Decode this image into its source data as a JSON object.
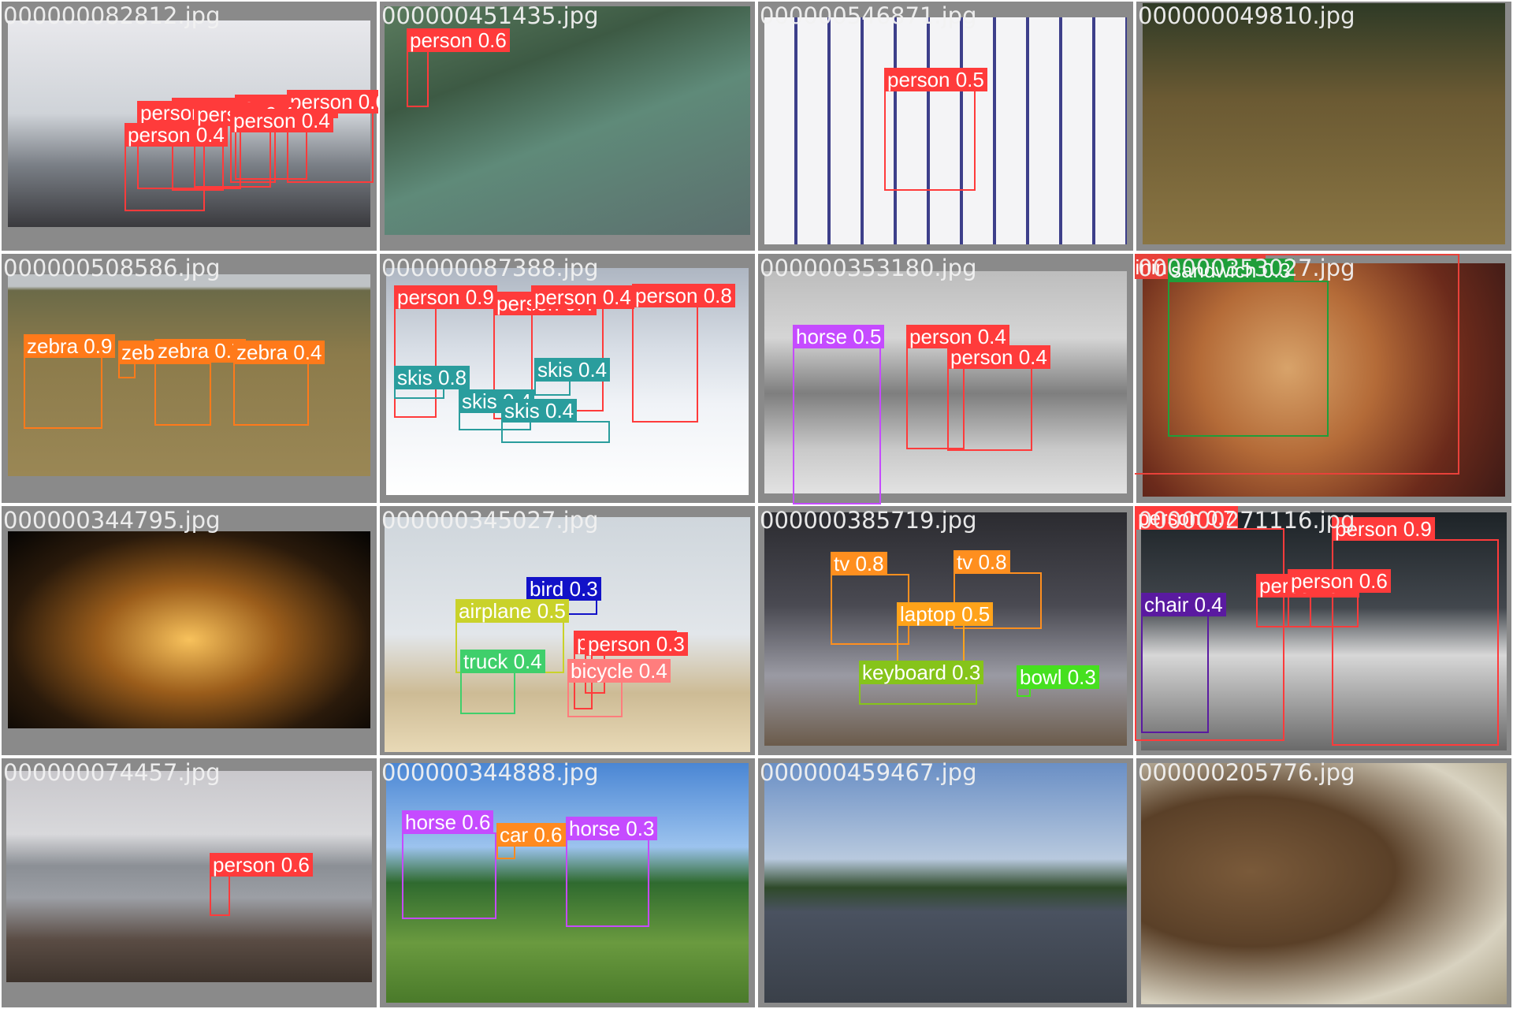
{
  "colors": {
    "person": "#ff3b3b",
    "zebra": "#ff7a1a",
    "skis": "#2a9d9d",
    "horse": "#c54bff",
    "sandwich": "#1f9e3a",
    "dining_table": "#e8413a",
    "bird": "#1212c8",
    "airplane": "#c9d22a",
    "truck": "#3fcf6b",
    "bicycle": "#ff7d7d",
    "tv": "#ff8f1f",
    "laptop": "#ffa31a",
    "keyboard": "#86c41a",
    "bowl": "#46e01f",
    "chair": "#5a1aa0",
    "car": "#ff8a1f"
  },
  "tiles": [
    {
      "filename": "000000082812.jpg",
      "labels": [
        "person 0.4",
        "person 0.6",
        "person 0.4",
        "person 0.4",
        "person 0.4",
        "person 0.4",
        "person 0.4"
      ]
    },
    {
      "filename": "000000451435.jpg",
      "labels": [
        "person 0.6"
      ]
    },
    {
      "filename": "000000546871.jpg",
      "labels": [
        "person 0.5"
      ]
    },
    {
      "filename": "000000049810.jpg",
      "labels": []
    },
    {
      "filename": "000000508586.jpg",
      "labels": [
        "zebra 0.9",
        "zebra 0.3",
        "zebra 0.7",
        "zebra 0.4"
      ]
    },
    {
      "filename": "000000087388.jpg",
      "labels": [
        "person 0.9",
        "person 0.4",
        "person 0.4",
        "person 0.8",
        "skis 0.8",
        "skis 0.4",
        "skis 0.4",
        "skis 0.4"
      ]
    },
    {
      "filename": "000000353180.jpg",
      "labels": [
        "horse 0.5",
        "person 0.4",
        "person 0.4"
      ]
    },
    {
      "filename": "000000353027.jpg",
      "labels": [
        "dining table 0.4",
        "sandwich 0.3"
      ]
    },
    {
      "filename": "000000344795.jpg",
      "labels": []
    },
    {
      "filename": "000000345027.jpg",
      "labels": [
        "bird 0.3",
        "airplane 0.5",
        "truck 0.4",
        "person 0.3",
        "person 0.3",
        "bicycle 0.4"
      ]
    },
    {
      "filename": "000000385719.jpg",
      "labels": [
        "tv 0.8",
        "tv 0.8",
        "laptop 0.5",
        "keyboard 0.3",
        "bowl 0.3"
      ]
    },
    {
      "filename": "000000271116.jpg",
      "labels": [
        "person 0.7",
        "person 0.9",
        "chair 0.4",
        "person 0.4",
        "person 0.6"
      ]
    },
    {
      "filename": "000000074457.jpg",
      "labels": [
        "person 0.6"
      ]
    },
    {
      "filename": "000000344888.jpg",
      "labels": [
        "horse 0.6",
        "car 0.6",
        "horse 0.3"
      ]
    },
    {
      "filename": "000000459467.jpg",
      "labels": []
    },
    {
      "filename": "000000205776.jpg",
      "labels": []
    }
  ]
}
